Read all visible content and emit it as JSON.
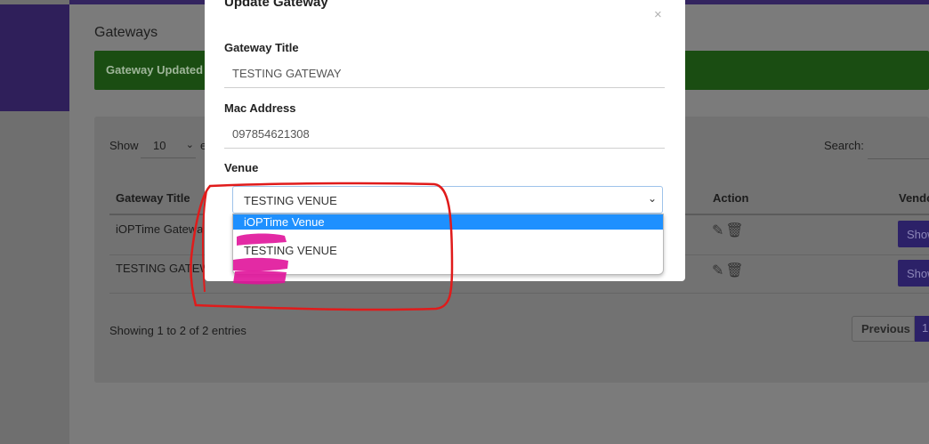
{
  "page": {
    "title": "Gateways",
    "alert": "Gateway Updated",
    "table_controls": {
      "show_label": "Show",
      "entries_value": "10",
      "entries_suffix": "e",
      "search_label": "Search:"
    },
    "columns": [
      "Gateway Title",
      "Action",
      "Vendo"
    ],
    "rows": [
      {
        "title": "iOPTime Gatewa",
        "show": "Show"
      },
      {
        "title": "TESTING GATEW",
        "show": "Show"
      }
    ],
    "footer": {
      "info": "Showing 1 to 2 of 2 entries",
      "prev": "Previous",
      "page": "1"
    }
  },
  "modal": {
    "title": "Update Gateway",
    "close_glyph": "×",
    "fields": {
      "gateway_title_label": "Gateway Title",
      "gateway_title_value": "TESTING GATEWAY",
      "mac_label": "Mac Address",
      "mac_value": "097854621308",
      "venue_label": "Venue",
      "venue_value": "TESTING VENUE"
    },
    "venue_options": [
      {
        "label": "iOPTime Venue",
        "selected": true
      },
      {
        "label": "TESTING VENUE",
        "selected": false
      }
    ]
  },
  "icons": {
    "edit": "edit-icon",
    "delete": "trash-icon",
    "chevron": "chevron-down-icon",
    "close": "close-icon"
  },
  "colors": {
    "accent": "#4a37c8",
    "alert_green": "#2a8a1e",
    "select_highlight": "#1e90ff",
    "annotation_red": "#e01b1b",
    "annotation_magenta": "#e0139a"
  }
}
